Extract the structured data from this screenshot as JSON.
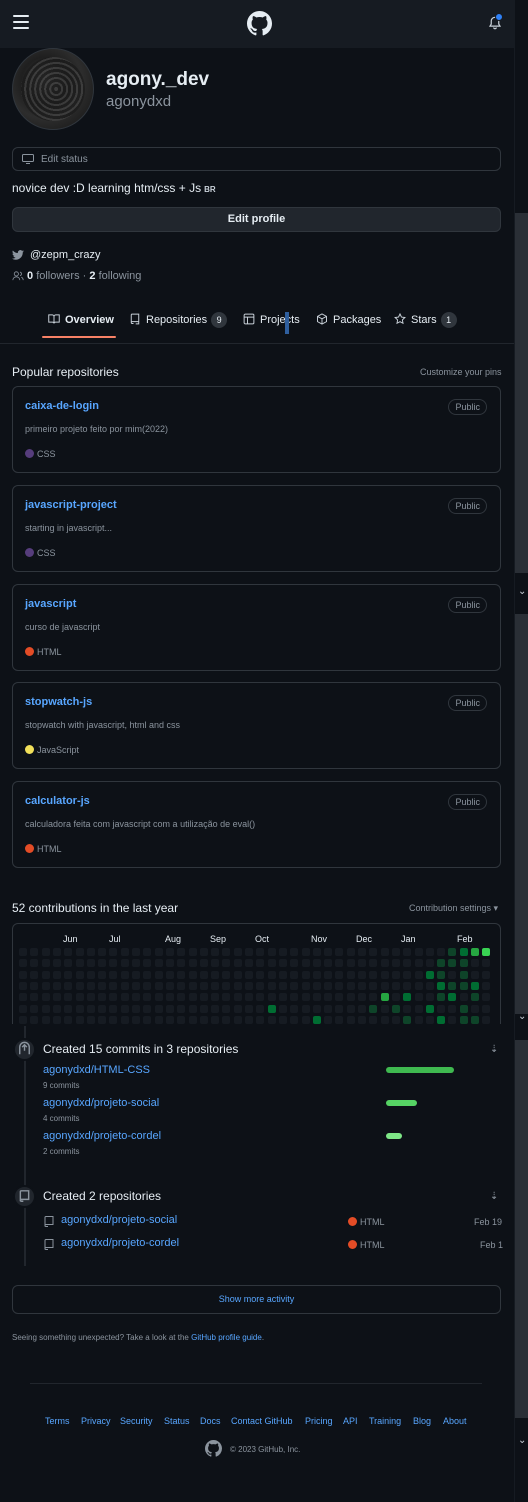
{
  "header": {
    "menu_icon": "hamburger-icon",
    "logo_icon": "github-mark-icon",
    "notifications_icon": "bell-icon"
  },
  "profile": {
    "display_name": "agony._dev",
    "username": "agonydxd",
    "edit_status_label": "Edit status",
    "bio": "novice dev :D learning htm/css + Js",
    "bio_flag": "BR",
    "edit_profile_label": "Edit profile",
    "twitter": "@zepm_crazy",
    "followers_count": "0",
    "followers_label": "followers",
    "separator": "·",
    "following_count": "2",
    "following_label": "following"
  },
  "tabs": [
    {
      "label": "Overview",
      "selected": true,
      "icon": "book-icon"
    },
    {
      "label": "Repositories",
      "count": "9",
      "icon": "repo-icon"
    },
    {
      "label": "Projects",
      "icon": "table-icon"
    },
    {
      "label": "Packages",
      "icon": "package-icon"
    },
    {
      "label": "Stars",
      "count": "1",
      "icon": "star-icon"
    }
  ],
  "popular": {
    "title": "Popular repositories",
    "customize_label": "Customize your pins",
    "repos": [
      {
        "name": "caixa-de-login",
        "visibility": "Public",
        "description": "primeiro projeto feito por mim(2022)",
        "language": "CSS",
        "color": "#563d7c"
      },
      {
        "name": "javascript-project",
        "visibility": "Public",
        "description": "starting in javascript...",
        "language": "CSS",
        "color": "#563d7c"
      },
      {
        "name": "javascript",
        "visibility": "Public",
        "description": "curso de javascript",
        "language": "HTML",
        "color": "#e34c26"
      },
      {
        "name": "stopwatch-js",
        "visibility": "Public",
        "description": "stopwatch with javascript, html and css",
        "language": "JavaScript",
        "color": "#f1e05a"
      },
      {
        "name": "calculator-js",
        "visibility": "Public",
        "description": "calculadora feita com javascript com a utilização de eval()",
        "language": "HTML",
        "color": "#e34c26"
      }
    ]
  },
  "contributions": {
    "title": "52 contributions in the last year",
    "settings_label": "Contribution settings ▾",
    "months": [
      "Jun",
      "Jul",
      "Aug",
      "Sep",
      "Oct",
      "Nov",
      "Dec",
      "Jan",
      "Feb"
    ]
  },
  "activity": {
    "commits_title": "Created 15 commits in 3 repositories",
    "commits": [
      {
        "repo": "agonydxd/HTML-CSS",
        "count": "9 commits",
        "share": 0.6
      },
      {
        "repo": "agonydxd/projeto-social",
        "count": "4 commits",
        "share": 0.27
      },
      {
        "repo": "agonydxd/projeto-cordel",
        "count": "2 commits",
        "share": 0.13
      }
    ],
    "repos_title": "Created 2 repositories",
    "new_repos": [
      {
        "repo": "agonydxd/projeto-social",
        "language": "HTML",
        "date": "Feb 19",
        "color": "#e34c26"
      },
      {
        "repo": "agonydxd/projeto-cordel",
        "language": "HTML",
        "date": "Feb 1",
        "color": "#e34c26"
      }
    ],
    "show_more_label": "Show more activity",
    "unexpected_text": "Seeing something unexpected? Take a look at the",
    "unexpected_link": "GitHub profile guide",
    "unexpected_end": "."
  },
  "footer": {
    "links": [
      "Terms",
      "Privacy",
      "Security",
      "Status",
      "Docs",
      "Contact GitHub",
      "Pricing",
      "API",
      "Training",
      "Blog",
      "About"
    ],
    "copyright": "© 2023 GitHub, Inc."
  },
  "colors": {
    "accent": "#58a6ff",
    "background": "#0d1117",
    "tab_underline": "#f78166"
  }
}
